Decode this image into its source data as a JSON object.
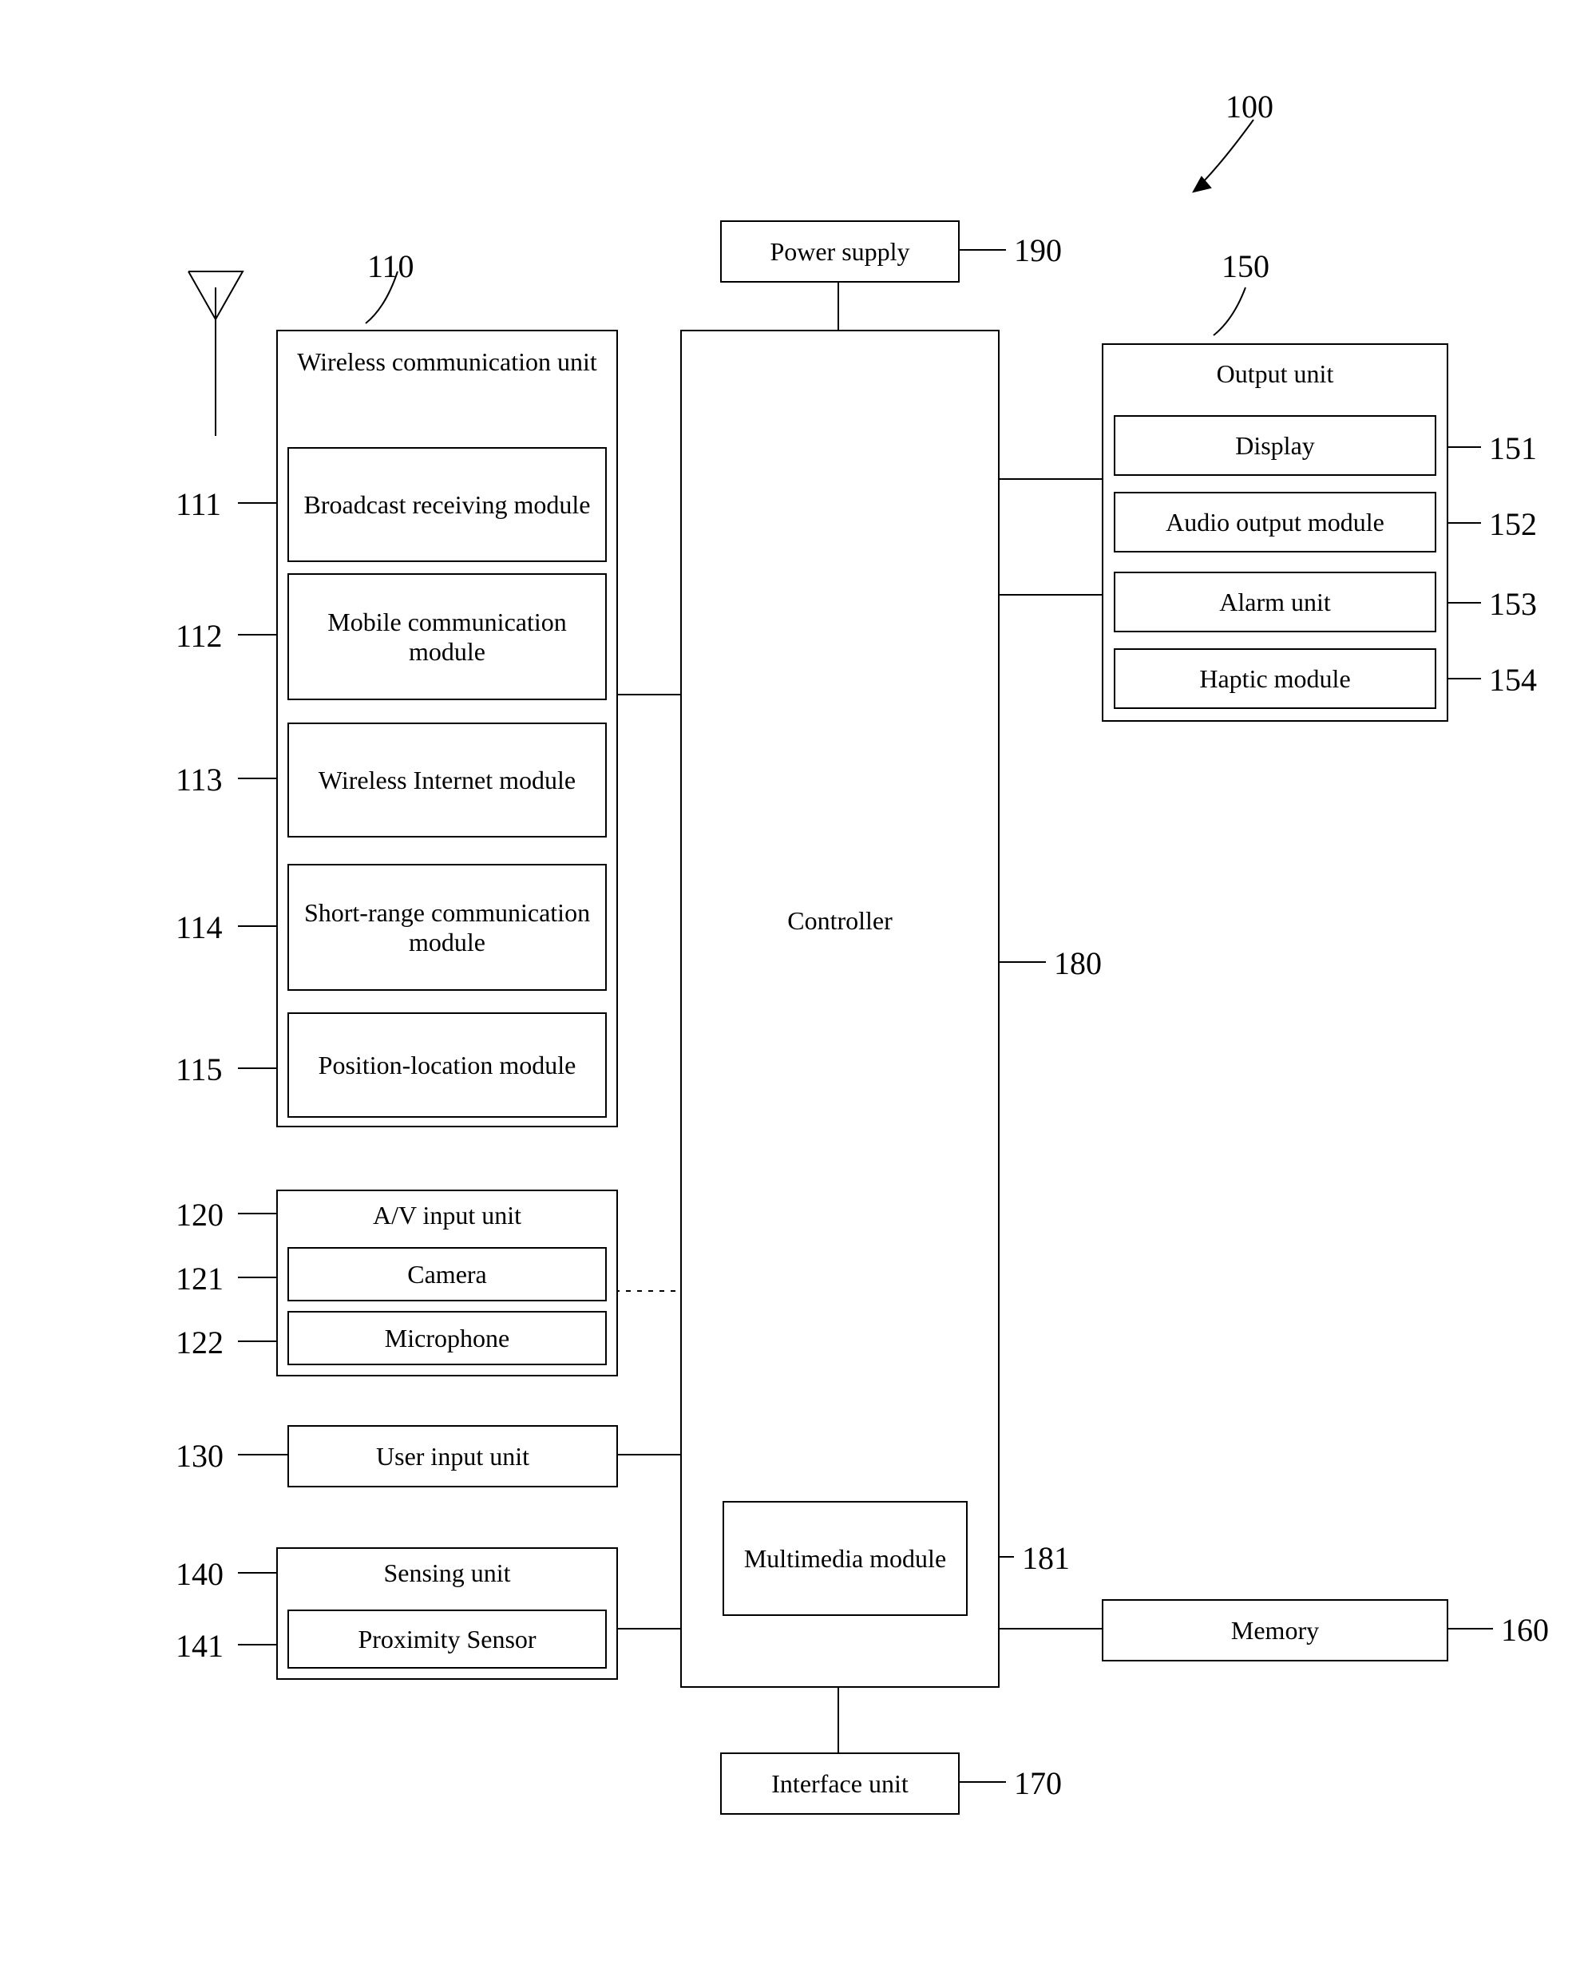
{
  "figure_ref": "100",
  "power_supply": {
    "label": "Power supply",
    "ref": "190"
  },
  "controller": {
    "label": "Controller",
    "ref": "180"
  },
  "multimedia": {
    "label": "Multimedia module",
    "ref": "181"
  },
  "interface_unit": {
    "label": "Interface unit",
    "ref": "170"
  },
  "memory": {
    "label": "Memory",
    "ref": "160"
  },
  "wireless": {
    "title": "Wireless communication unit",
    "ref": "110",
    "items": [
      {
        "label": "Broadcast receiving module",
        "ref": "111"
      },
      {
        "label": "Mobile communication module",
        "ref": "112"
      },
      {
        "label": "Wireless Internet module",
        "ref": "113"
      },
      {
        "label": "Short-range communication module",
        "ref": "114"
      },
      {
        "label": "Position-location module",
        "ref": "115"
      }
    ]
  },
  "av_input": {
    "title": "A/V input unit",
    "ref": "120",
    "items": [
      {
        "label": "Camera",
        "ref": "121"
      },
      {
        "label": "Microphone",
        "ref": "122"
      }
    ]
  },
  "user_input": {
    "label": "User input unit",
    "ref": "130"
  },
  "sensing": {
    "title": "Sensing unit",
    "ref": "140",
    "items": [
      {
        "label": "Proximity Sensor",
        "ref": "141"
      }
    ]
  },
  "output": {
    "title": "Output unit",
    "ref": "150",
    "items": [
      {
        "label": "Display",
        "ref": "151"
      },
      {
        "label": "Audio output module",
        "ref": "152"
      },
      {
        "label": "Alarm  unit",
        "ref": "153"
      },
      {
        "label": "Haptic module",
        "ref": "154"
      }
    ]
  }
}
